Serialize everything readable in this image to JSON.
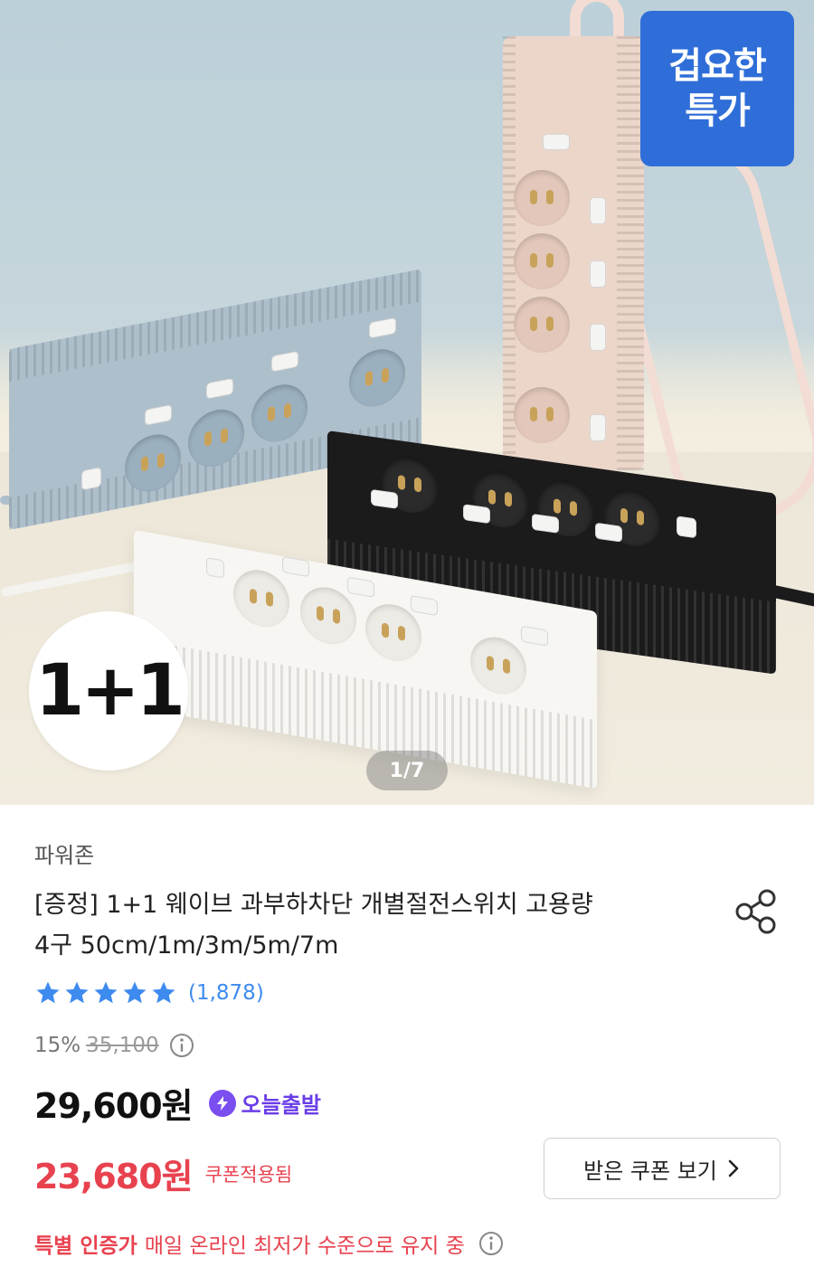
{
  "hero": {
    "badge_special_line1": "겁요한",
    "badge_special_line2": "특가",
    "badge_oneplus": "1+1",
    "page_indicator": "1/7"
  },
  "product": {
    "brand": "파워존",
    "title_line1": "[증정] 1+1 웨이브 과부하차단 개별절전스위치 고용량",
    "title_line2": "4구 50cm/1m/3m/5m/7m",
    "rating_stars": 5,
    "review_count": "(1,878)",
    "discount_rate": "15%",
    "original_price": "35,100",
    "price": "29,600원",
    "delivery_badge": "오늘출발",
    "coupon_price": "23,680원",
    "coupon_applied_label": "쿠폰적용됨",
    "coupon_button_label": "받은 쿠폰 보기",
    "lowest_price_highlight": "특별 인증가",
    "lowest_price_text": "매일 온라인 최저가 수준으로 유지 중"
  },
  "icons": {
    "share": "share-icon",
    "star": "star-icon",
    "info": "info-icon",
    "bolt": "bolt-icon",
    "chevron": "chevron-right-icon"
  },
  "colors": {
    "accent_red": "#e8424f",
    "review_blue": "#3e8bf0",
    "star_blue": "#3e8bf0",
    "delivery_purple": "#6a3de8",
    "special_badge_blue": "#2f6ed8"
  }
}
